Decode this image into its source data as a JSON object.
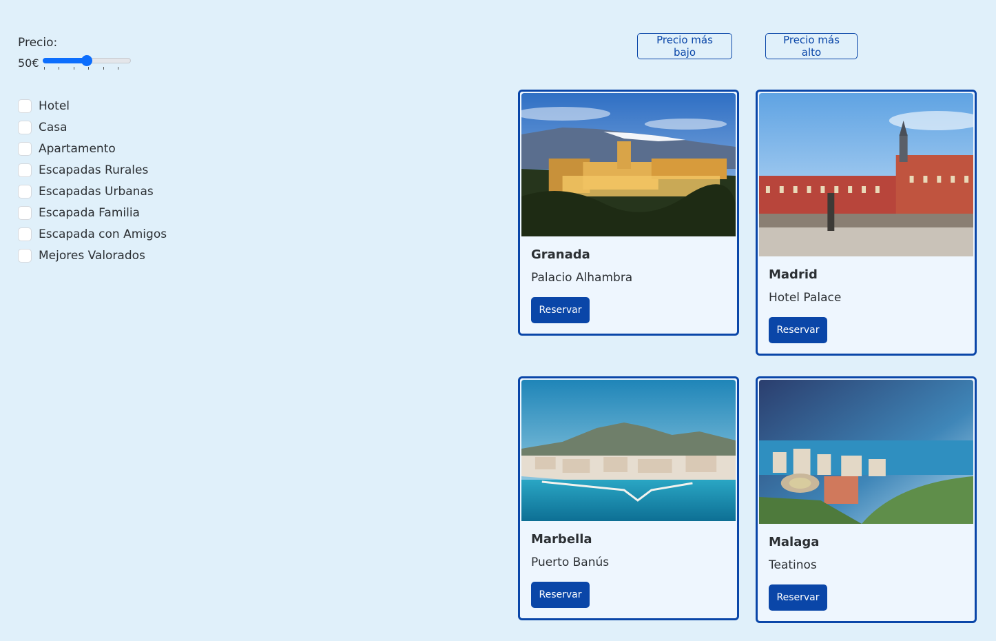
{
  "filters": {
    "price_label": "Precio:",
    "price_value": "50€",
    "price_fraction": 0.5,
    "slider_ticks": 6,
    "options": [
      "Hotel",
      "Casa",
      "Apartamento",
      "Escapadas Rurales",
      "Escapadas Urbanas",
      "Escapada Familia",
      "Escapada con Amigos",
      "Mejores Valorados"
    ]
  },
  "sort": {
    "low_label": "Precio más bajo",
    "high_label": "Precio más alto"
  },
  "cards": [
    {
      "city": "Granada",
      "place": "Palacio Alhambra",
      "button": "Reservar"
    },
    {
      "city": "Madrid",
      "place": "Hotel Palace",
      "button": "Reservar"
    },
    {
      "city": "Marbella",
      "place": "Puerto Banús",
      "button": "Reservar"
    },
    {
      "city": "Malaga",
      "place": "Teatinos",
      "button": "Reservar"
    }
  ],
  "colors": {
    "background": "#e0f0fa",
    "accent": "#0a46a8",
    "slider": "#0d6efd",
    "card_bg": "#eef6fe"
  }
}
